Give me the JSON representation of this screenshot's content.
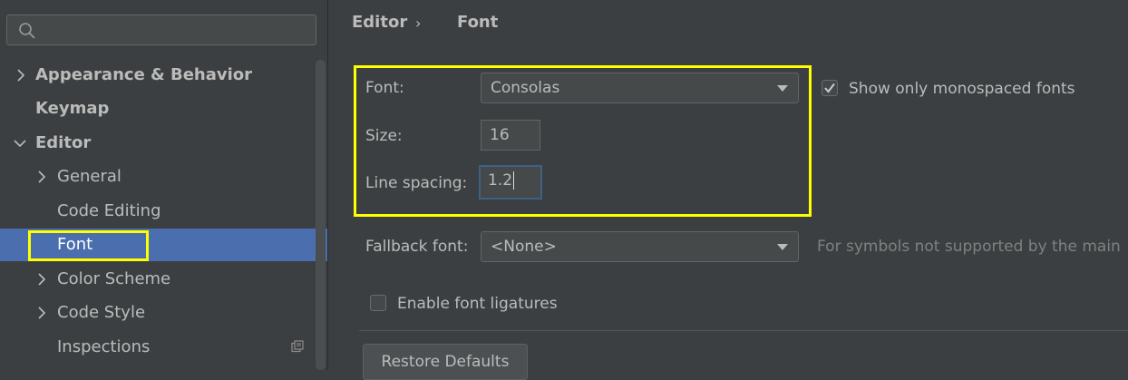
{
  "search": {
    "placeholder": "",
    "value": ""
  },
  "sidebar": {
    "items": [
      {
        "label": "Appearance & Behavior",
        "expanded": false
      },
      {
        "label": "Keymap"
      },
      {
        "label": "Editor",
        "expanded": true
      },
      {
        "label": "General",
        "expanded": false
      },
      {
        "label": "Code Editing"
      },
      {
        "label": "Font",
        "selected": true
      },
      {
        "label": "Color Scheme",
        "expanded": false
      },
      {
        "label": "Code Style",
        "expanded": false
      },
      {
        "label": "Inspections"
      }
    ]
  },
  "breadcrumb": {
    "parent": "Editor",
    "current": "Font"
  },
  "font": {
    "label": "Font:",
    "value": "Consolas",
    "mono_label": "Show only monospaced fonts",
    "mono_checked": true
  },
  "size": {
    "label": "Size:",
    "value": "16"
  },
  "line_spacing": {
    "label": "Line spacing:",
    "value": "1.2"
  },
  "fallback": {
    "label": "Fallback font:",
    "value": "<None>",
    "hint": "For symbols not supported by the main"
  },
  "ligatures": {
    "label": "Enable font ligatures",
    "checked": false
  },
  "restore_label": "Restore Defaults",
  "colors": {
    "selection": "#4b6eaf",
    "highlight": "#ffff00",
    "background": "#3c3f41"
  }
}
